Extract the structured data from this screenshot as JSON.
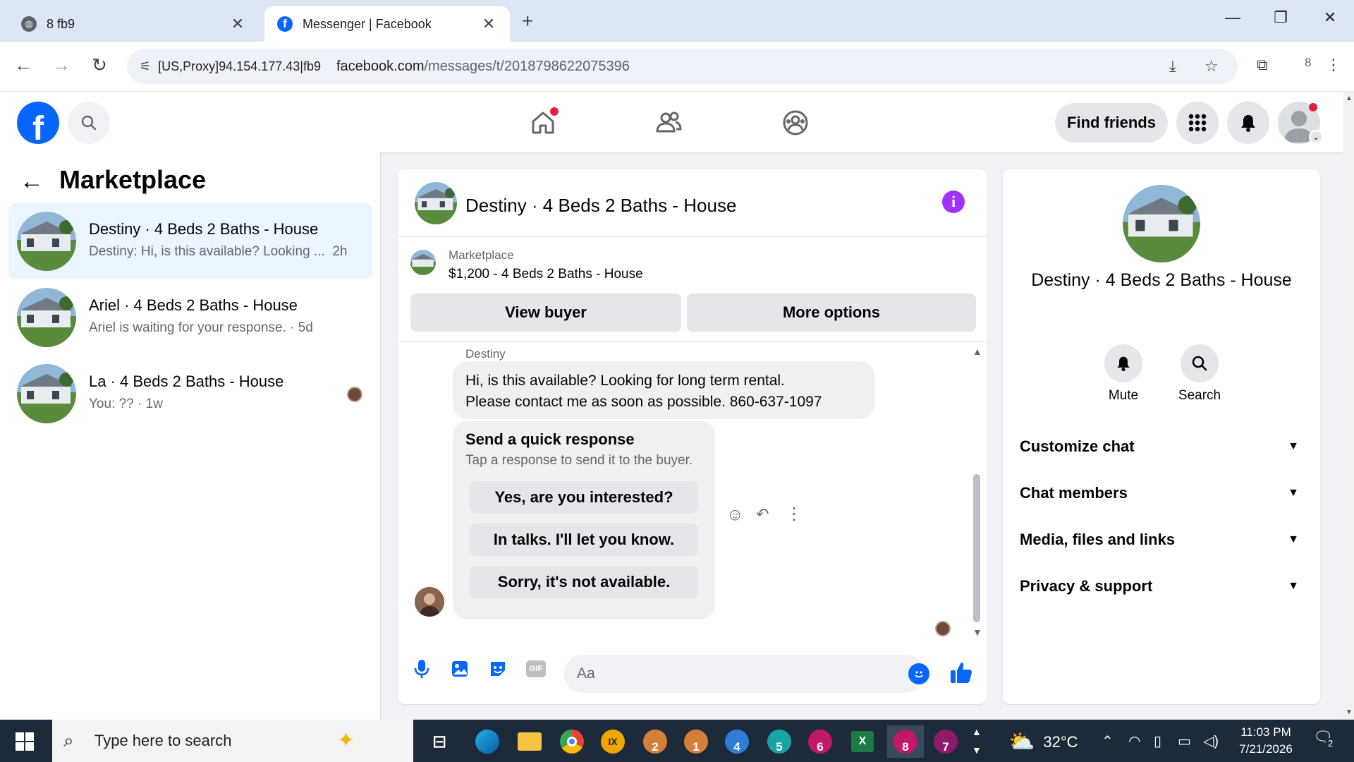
{
  "browser": {
    "tabs": [
      {
        "title": "8 fb9",
        "active": false
      },
      {
        "title": "Messenger | Facebook",
        "active": true
      }
    ],
    "address": {
      "proxy_label": "[US,Proxy]94.154.177.43|fb9",
      "url_host": "facebook.com",
      "url_path": "/messages/t/2018798622075396"
    },
    "profile_badge": "8"
  },
  "fb_header": {
    "logo": "f",
    "find_friends_label": "Find friends"
  },
  "left_panel": {
    "title": "Marketplace",
    "conversations": [
      {
        "title": "Destiny · 4 Beds 2 Baths - House",
        "preview": "Destiny: Hi, is this available? Looking ...",
        "time": "2h",
        "selected": true
      },
      {
        "title": "Ariel · 4 Beds 2 Baths - House",
        "preview": "Ariel is waiting for your response. · 5d",
        "time": "",
        "selected": false
      },
      {
        "title": "La · 4 Beds 2 Baths - House",
        "preview": "You: ?? · 1w",
        "time": "",
        "selected": false
      }
    ]
  },
  "chat": {
    "title": "Destiny · 4 Beds 2 Baths - House",
    "listing": {
      "label": "Marketplace",
      "summary": "$1,200 - 4 Beds 2 Baths - House",
      "view_buyer_label": "View buyer",
      "more_options_label": "More options"
    },
    "sender_name": "Destiny",
    "message_line1": "Hi, is this available? Looking for long term rental.",
    "message_line2": "Please contact me as soon as possible. 860-637-1097",
    "quick_response": {
      "title": "Send a quick response",
      "subtitle": "Tap a response to send it to the buyer.",
      "options": [
        "Yes, are you interested?",
        "In talks. I'll let you know.",
        "Sorry, it's not available."
      ]
    },
    "composer_placeholder": "Aa",
    "gif_label": "GIF"
  },
  "right_panel": {
    "name": "Destiny · 4 Beds 2 Baths - House",
    "actions": [
      {
        "label": "Mute",
        "icon": "bell-icon"
      },
      {
        "label": "Search",
        "icon": "search-icon"
      }
    ],
    "sections": [
      "Customize chat",
      "Chat members",
      "Media, files and links",
      "Privacy & support"
    ]
  },
  "taskbar": {
    "search_placeholder": "Type here to search",
    "apps": [
      "2",
      "1",
      "4",
      "5",
      "6",
      "8",
      "7"
    ],
    "weather": "32°C",
    "time": "11:03 PM",
    "date": "7/21/2026",
    "notifications": "2"
  },
  "colors": {
    "fb_blue": "#0866ff",
    "messenger_purple": "#a033ff",
    "selected_bg": "#ebf5ff"
  }
}
